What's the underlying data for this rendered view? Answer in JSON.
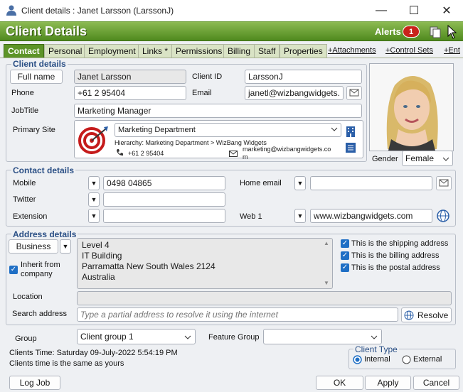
{
  "window": {
    "title": "Client details : Janet Larsson  (LarssonJ)",
    "minimize": "—",
    "maximize": "☐",
    "close": "✕"
  },
  "header": {
    "title": "Client Details",
    "alerts_label": "Alerts",
    "alerts_count": "1"
  },
  "tabs": [
    {
      "label": "Contact"
    },
    {
      "label": "Personal"
    },
    {
      "label": "Employment"
    },
    {
      "label": "Links *"
    },
    {
      "label": "Permissions"
    },
    {
      "label": "Billing"
    },
    {
      "label": "Staff"
    },
    {
      "label": "Properties"
    }
  ],
  "tab_links": [
    "+Attachments",
    "+Control Sets",
    "+Ent"
  ],
  "client": {
    "section_title": "Client details",
    "fullname_button": "Full name",
    "fullname_value": "Janet Larsson",
    "clientid_label": "Client ID",
    "clientid_value": "LarssonJ",
    "phone_label": "Phone",
    "phone_value": "+61 2 95404",
    "email_label": "Email",
    "email_value": "janetl@wizbangwidgets.",
    "jobtitle_label": "JobTitle",
    "jobtitle_value": "Marketing Manager",
    "site_label": "Primary Site",
    "site_value": "Marketing Department",
    "site_hierarchy": "Hierarchy: Marketing Department > WizBang Widgets",
    "site_phone": "+61 2 95404",
    "site_email": "marketing@wizbangwidgets.co m",
    "gender_label": "Gender",
    "gender_value": "Female"
  },
  "contact": {
    "section_title": "Contact details",
    "mobile_label": "Mobile",
    "mobile_value": "0498 04865",
    "homeemail_label": "Home email",
    "homeemail_value": "",
    "twitter_label": "Twitter",
    "twitter_value": "",
    "extension_label": "Extension",
    "extension_value": "",
    "web_label": "Web 1",
    "web_value": "www.wizbangwidgets.com"
  },
  "address": {
    "section_title": "Address details",
    "type_button": "Business",
    "inherit_label": "Inherit from company",
    "lines": [
      "Level 4",
      "IT Building",
      "Parramatta New South Wales 2124",
      "Australia"
    ],
    "shipping": "This is the shipping address",
    "billing": "This is the billing address",
    "postal": "This is the postal address",
    "location_label": "Location",
    "location_value": "",
    "search_label": "Search address",
    "search_placeholder": "Type a partial address to resolve it using the internet",
    "resolve_button": "Resolve"
  },
  "bottom": {
    "group_label": "Group",
    "group_value": "Client group 1",
    "feature_label": "Feature Group",
    "feature_value": "",
    "time_line1": "Clients Time: Saturday 09-July-2022 5:54:19 PM",
    "time_line2": "Clients time is the same as yours",
    "clienttype_title": "Client Type",
    "internal": "Internal",
    "external": "External"
  },
  "footer": {
    "logjob": "Log Job",
    "ok": "OK",
    "apply": "Apply",
    "cancel": "Cancel"
  },
  "colors": {
    "header_green": "#5d9428",
    "section_blue": "#2a4f85",
    "alert_red": "#c8231b",
    "check_blue": "#1f6fc5"
  }
}
